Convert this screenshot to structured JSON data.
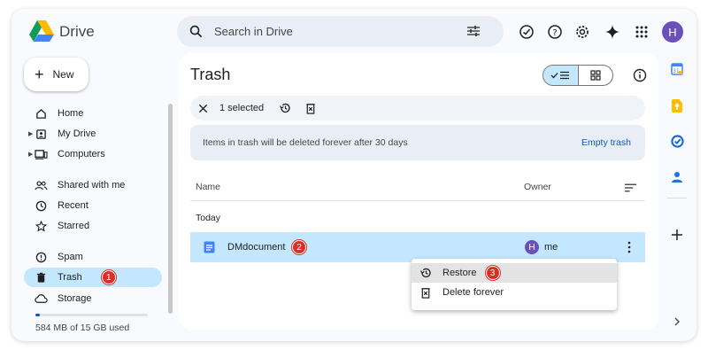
{
  "app": {
    "name": "Drive"
  },
  "search": {
    "placeholder": "Search in Drive"
  },
  "user": {
    "initial": "H"
  },
  "new_button": {
    "label": "New"
  },
  "sidebar": {
    "items": [
      {
        "label": "Home"
      },
      {
        "label": "My Drive"
      },
      {
        "label": "Computers"
      },
      {
        "label": "Shared with me"
      },
      {
        "label": "Recent"
      },
      {
        "label": "Starred"
      },
      {
        "label": "Spam"
      },
      {
        "label": "Trash",
        "badge": "1"
      },
      {
        "label": "Storage"
      }
    ],
    "storage_text": "584 MB of 15 GB used",
    "storage_used_fraction": 0.04
  },
  "main": {
    "title": "Trash",
    "selection": {
      "label": "1 selected"
    },
    "banner": {
      "text": "Items in trash will be deleted forever after 30 days",
      "action": "Empty trash"
    },
    "columns": {
      "name": "Name",
      "owner": "Owner"
    },
    "group": "Today",
    "file": {
      "name": "DMdocument",
      "badge": "2",
      "owner_initial": "H",
      "owner": "me"
    }
  },
  "context_menu": {
    "items": [
      {
        "label": "Restore",
        "badge": "3"
      },
      {
        "label": "Delete forever"
      }
    ]
  },
  "colors": {
    "accent": "#0b57d0",
    "selected_bg": "#c2e7ff",
    "badge": "#d93025",
    "avatar": "#6b4fbb"
  }
}
